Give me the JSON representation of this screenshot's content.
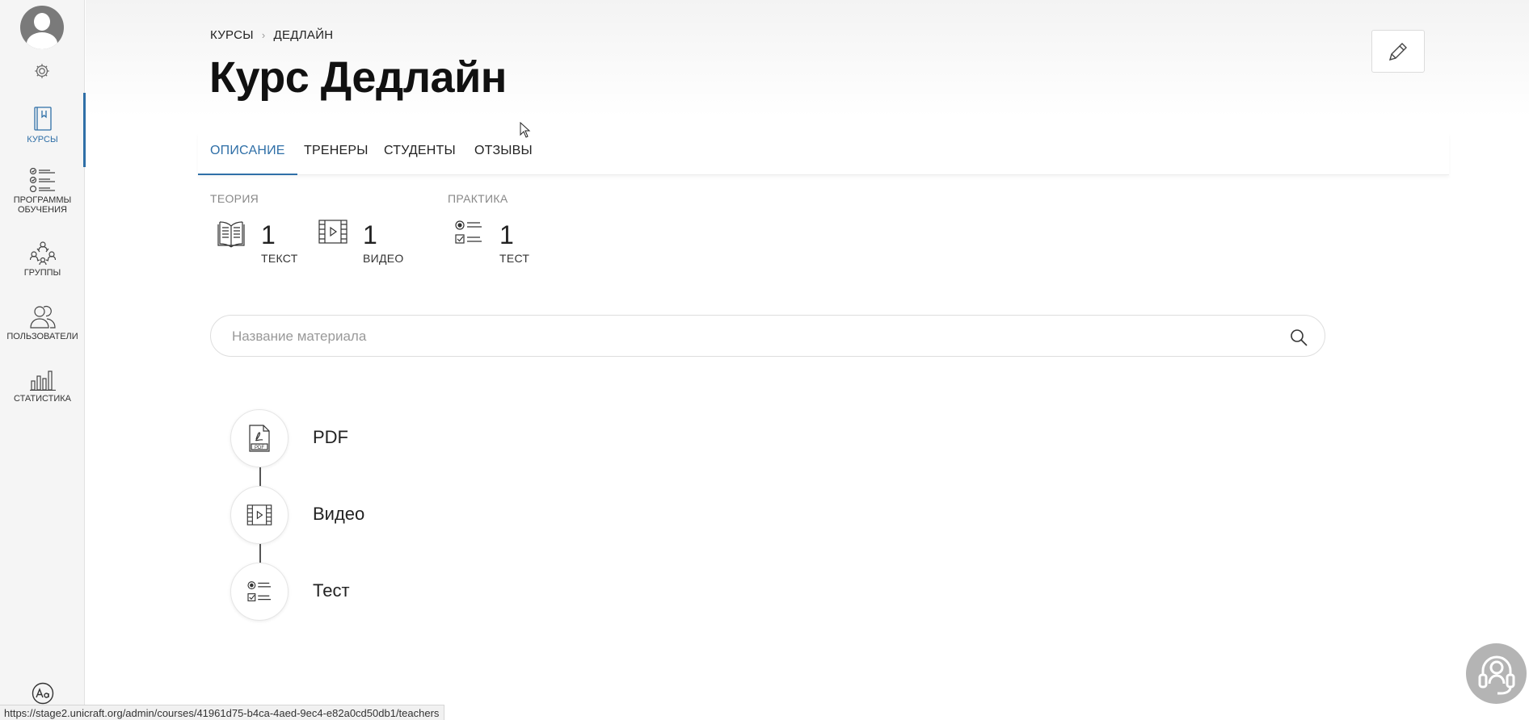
{
  "sidebar": {
    "items": [
      {
        "label": "КУРСЫ",
        "icon": "book-icon",
        "active": true
      },
      {
        "label": "ПРОГРАММЫ ОБУЧЕНИЯ",
        "icon": "checklist-icon",
        "active": false
      },
      {
        "label": "ГРУППЫ",
        "icon": "group-icon",
        "active": false
      },
      {
        "label": "ПОЛЬЗОВАТЕЛИ",
        "icon": "users-icon",
        "active": false
      },
      {
        "label": "СТАТИСТИКА",
        "icon": "bar-chart-icon",
        "active": false
      }
    ],
    "font_button_label": "Aa"
  },
  "breadcrumb": {
    "items": [
      "КУРСЫ",
      "ДЕДЛАЙН"
    ]
  },
  "page": {
    "title": "Курс Дедлайн"
  },
  "tabs": [
    {
      "label": "ОПИСАНИЕ",
      "active": true
    },
    {
      "label": "ТРЕНЕРЫ",
      "active": false
    },
    {
      "label": "СТУДЕНТЫ",
      "active": false
    },
    {
      "label": "ОТЗЫВЫ",
      "active": false
    }
  ],
  "stats": {
    "theory_label": "ТЕОРИЯ",
    "practice_label": "ПРАКТИКА",
    "items": [
      {
        "value": "1",
        "caption": "ТЕКСТ",
        "icon": "open-book-icon"
      },
      {
        "value": "1",
        "caption": "ВИДЕО",
        "icon": "video-icon"
      },
      {
        "value": "1",
        "caption": "ТЕСТ",
        "icon": "test-icon"
      }
    ]
  },
  "search": {
    "placeholder": "Название материала",
    "value": ""
  },
  "materials": [
    {
      "label": "PDF",
      "icon": "pdf-icon"
    },
    {
      "label": "Видео",
      "icon": "video-icon"
    },
    {
      "label": "Тест",
      "icon": "test-icon"
    }
  ],
  "status_url": "https://stage2.unicraft.org/admin/courses/41961d75-b4ca-4aed-9ec4-e82a0cd50db1/teachers",
  "colors": {
    "accent": "#2f6fa7",
    "sidebar_bg": "#f5f5f5",
    "support_bg": "#b4b4b4"
  }
}
